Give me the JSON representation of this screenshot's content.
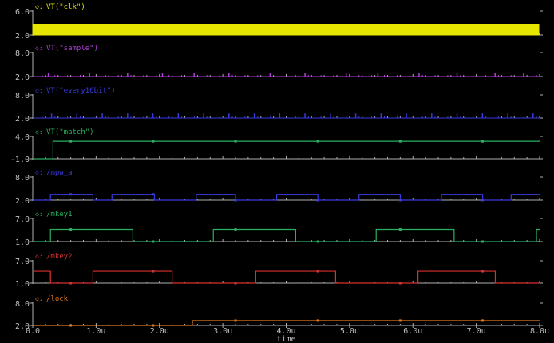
{
  "viewer": {
    "x_axis": {
      "label": "time",
      "tick_labels": [
        "0.0",
        "1.0u",
        "2.0u",
        "3.0u",
        "4.0u",
        "5.0u",
        "6.0u",
        "7.0u",
        "8.0u"
      ],
      "range": [
        0,
        8
      ]
    },
    "x_unit": "u",
    "background_color": "#000000",
    "axis_color": "#bfbfbf",
    "frame_color": "#b0b0b0"
  },
  "signals": [
    {
      "id": "clk",
      "name": "VT(\"clk\")",
      "marker": "◇",
      "color": "#e6e600",
      "y_labels": [
        "6.0",
        "2.0"
      ],
      "y_range": [
        -1,
        7
      ],
      "kind": "clock",
      "low": 2.0,
      "high": 3.0,
      "period_u": 0.025
    },
    {
      "id": "sample",
      "name": "VT(\"sample\")",
      "marker": "◇",
      "color": "#b040d8",
      "y_labels": [
        "8.0",
        "2.0"
      ],
      "y_range": [
        1.5,
        9
      ],
      "kind": "pulses",
      "low": 2.0,
      "high": 2.3,
      "pulse_height": 3.0,
      "pulse_width_u": 0.012,
      "pulses_u": [
        0.25,
        0.9,
        1.5,
        2.05,
        2.55,
        3.1,
        3.75,
        4.3,
        4.95,
        5.45,
        6.1,
        6.7,
        7.3,
        7.75
      ]
    },
    {
      "id": "every16bit",
      "name": "VT(\"every16bit\")",
      "marker": "◇",
      "color": "#3a3ae0",
      "y_labels": [
        "8.0",
        "2.0"
      ],
      "y_range": [
        1.5,
        9
      ],
      "kind": "pulses",
      "low": 2.0,
      "high": 2.3,
      "pulse_height": 3.2,
      "pulse_width_u": 0.012,
      "pulses_u": [
        0.3,
        0.7,
        1.1,
        1.5,
        1.9,
        2.3,
        2.7,
        3.1,
        3.5,
        3.9,
        4.3,
        4.7,
        5.1,
        5.5,
        5.9,
        6.3,
        6.7,
        7.1,
        7.5,
        7.9
      ]
    },
    {
      "id": "match",
      "name": "VT(\"match\")",
      "marker": "◇",
      "color": "#2ab060",
      "y_labels": [
        "4.0",
        "-1.0"
      ],
      "y_range": [
        -1.5,
        4.5
      ],
      "kind": "steps",
      "points_u": [
        [
          0,
          -1.0
        ],
        [
          0.32,
          -1.0
        ],
        [
          0.32,
          2.9
        ],
        [
          8.0,
          2.9
        ]
      ]
    },
    {
      "id": "mpw_a",
      "name": "/mpw_a",
      "marker": "◇",
      "color": "#3a3ae0",
      "y_labels": [
        "8.0",
        "2.0"
      ],
      "y_range": [
        1.5,
        9
      ],
      "kind": "steps",
      "points_u": [
        [
          0,
          2.0
        ],
        [
          0.28,
          2.0
        ],
        [
          0.28,
          3.5
        ],
        [
          0.95,
          3.5
        ],
        [
          0.95,
          2.0
        ],
        [
          1.25,
          2.0
        ],
        [
          1.25,
          3.5
        ],
        [
          1.92,
          3.5
        ],
        [
          1.92,
          2.0
        ],
        [
          2.58,
          2.0
        ],
        [
          2.58,
          3.5
        ],
        [
          3.2,
          3.5
        ],
        [
          3.2,
          2.0
        ],
        [
          3.85,
          2.0
        ],
        [
          3.85,
          3.5
        ],
        [
          4.5,
          3.5
        ],
        [
          4.5,
          2.0
        ],
        [
          5.15,
          2.0
        ],
        [
          5.15,
          3.5
        ],
        [
          5.8,
          3.5
        ],
        [
          5.8,
          2.0
        ],
        [
          6.45,
          2.0
        ],
        [
          6.45,
          3.5
        ],
        [
          7.1,
          3.5
        ],
        [
          7.1,
          2.0
        ],
        [
          7.55,
          2.0
        ],
        [
          7.55,
          3.5
        ],
        [
          8.0,
          3.5
        ]
      ]
    },
    {
      "id": "mkey1",
      "name": "/mkey1",
      "marker": "◇",
      "color": "#2ab060",
      "y_labels": [
        "7.0",
        "1.0"
      ],
      "y_range": [
        0.5,
        8.5
      ],
      "kind": "steps",
      "points_u": [
        [
          0,
          1.0
        ],
        [
          0.28,
          1.0
        ],
        [
          0.28,
          4.2
        ],
        [
          1.27,
          4.2
        ],
        [
          1.27,
          4.2
        ],
        [
          1.58,
          4.2
        ],
        [
          1.58,
          1.0
        ],
        [
          2.85,
          1.0
        ],
        [
          2.85,
          4.2
        ],
        [
          3.85,
          4.2
        ],
        [
          4.15,
          4.2
        ],
        [
          4.15,
          1.0
        ],
        [
          5.42,
          1.0
        ],
        [
          5.42,
          4.2
        ],
        [
          6.4,
          4.2
        ],
        [
          6.65,
          4.2
        ],
        [
          6.65,
          1.0
        ],
        [
          7.95,
          1.0
        ],
        [
          7.95,
          4.2
        ],
        [
          8.0,
          4.2
        ]
      ]
    },
    {
      "id": "mkey2",
      "name": "/mkey2",
      "marker": "◇",
      "color": "#d83030",
      "y_labels": [
        "7.0",
        "1.0"
      ],
      "y_range": [
        0.5,
        8.5
      ],
      "kind": "steps",
      "points_u": [
        [
          0,
          4.2
        ],
        [
          0.28,
          4.2
        ],
        [
          0.28,
          1.0
        ],
        [
          0.95,
          1.0
        ],
        [
          0.95,
          4.2
        ],
        [
          2.2,
          4.2
        ],
        [
          2.2,
          1.0
        ],
        [
          3.52,
          1.0
        ],
        [
          3.52,
          4.2
        ],
        [
          4.78,
          4.2
        ],
        [
          4.78,
          1.0
        ],
        [
          6.08,
          1.0
        ],
        [
          6.08,
          4.2
        ],
        [
          7.3,
          4.2
        ],
        [
          7.3,
          1.0
        ],
        [
          8.0,
          1.0
        ]
      ]
    },
    {
      "id": "lock",
      "name": "/lock",
      "marker": "◇",
      "color": "#e07820",
      "y_labels": [
        "8.0",
        "2.0"
      ],
      "y_range": [
        1.5,
        9
      ],
      "kind": "steps",
      "points_u": [
        [
          0,
          2.0
        ],
        [
          2.52,
          2.0
        ],
        [
          2.52,
          3.3
        ],
        [
          8.0,
          3.3
        ]
      ]
    }
  ]
}
